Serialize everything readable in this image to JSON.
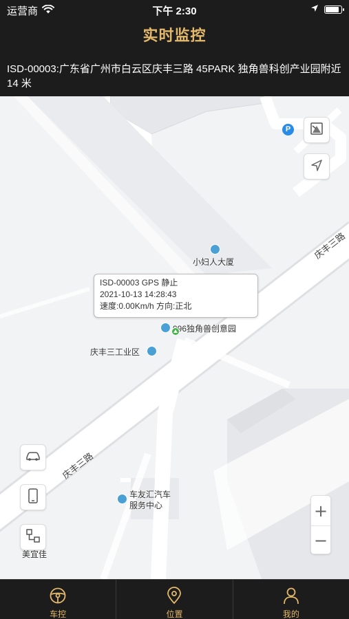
{
  "status_bar": {
    "carrier": "运营商",
    "time": "下午 2:30",
    "battery_level": 0.9
  },
  "nav": {
    "title": "实时监控"
  },
  "address": {
    "text": "ISD-00003:广东省广州市白云区庆丰三路 45PARK 独角兽科创产业园附近 14 米"
  },
  "map": {
    "pois": {
      "xiaofuren": "小妇人大厦",
      "unicorn": "996独角兽创意园",
      "qingfeng_industrial": "庆丰三工业区",
      "car_service_line1": "车友汇汽车",
      "car_service_line2": "服务中心",
      "meiyijia": "美宜佳"
    },
    "roads": {
      "upper": "庆丰三路",
      "lower": "庆丰三路"
    },
    "parking_label": "P",
    "info_window": {
      "line1": "ISD-00003 GPS 静止",
      "line2": "2021-10-13 14:28:43",
      "line3": "速度:0.00Km/h 方向:正北"
    },
    "zoom": {
      "in": "+",
      "out": "−"
    }
  },
  "tabs": [
    {
      "label": "车控",
      "icon": "steering-wheel-icon"
    },
    {
      "label": "位置",
      "icon": "location-pin-icon"
    },
    {
      "label": "我的",
      "icon": "person-icon"
    }
  ],
  "colors": {
    "accent": "#e4b96a",
    "bar_bg": "#1c1c1c",
    "map_bg": "#f2f3f5",
    "road": "#ffffff"
  }
}
